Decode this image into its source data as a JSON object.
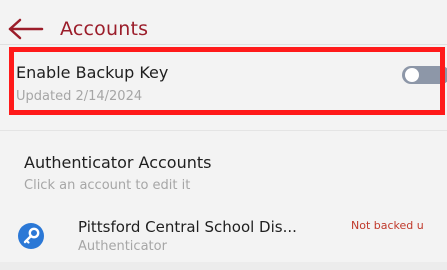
{
  "header": {
    "title": "Accounts",
    "back_icon": "arrow-left-icon"
  },
  "backup": {
    "title": "Enable Backup Key",
    "subtitle": "Updated 2/14/2024",
    "toggle_state": "off"
  },
  "section": {
    "title": "Authenticator Accounts",
    "subtitle": "Click an account to edit it"
  },
  "accounts": [
    {
      "name": "Pittsford Central School Dis...",
      "type": "Authenticator",
      "status": "Not backed u",
      "icon": "key-icon"
    }
  ],
  "colors": {
    "accent": "#9b1d2a",
    "highlight": "#ff1a1a",
    "icon_bg": "#2b78d6",
    "status": "#c0392b",
    "toggle_off": "#8d97a8"
  }
}
